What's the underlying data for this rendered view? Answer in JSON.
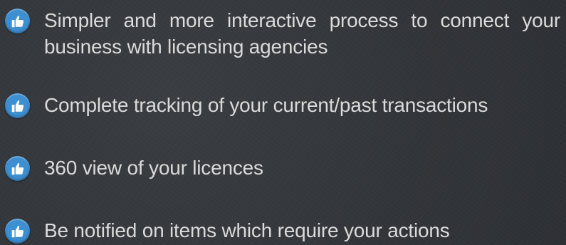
{
  "colors": {
    "background": "#33373c",
    "bullet": "#3d8fd1",
    "text": "#d9dadb"
  },
  "features": [
    {
      "icon": "thumbs-up-icon",
      "text": "Simpler and more interactive process to connect your business with licensing agencies"
    },
    {
      "icon": "thumbs-up-icon",
      "text": "Complete tracking of your current/past transactions"
    },
    {
      "icon": "thumbs-up-icon",
      "text": "360 view of your licences"
    },
    {
      "icon": "thumbs-up-icon",
      "text": "Be notified on items which require your actions"
    }
  ]
}
